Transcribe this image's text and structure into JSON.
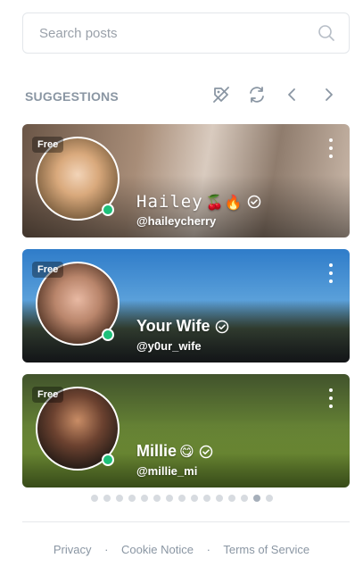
{
  "search": {
    "placeholder": "Search posts"
  },
  "suggestions": {
    "title": "SUGGESTIONS",
    "cards": [
      {
        "free_label": "Free",
        "name": "Hailey",
        "emoji": "🍒🔥",
        "handle": "@haileycherry",
        "verified": true,
        "online": true
      },
      {
        "free_label": "Free",
        "name": "Your Wife",
        "emoji": "",
        "handle": "@y0ur_wife",
        "verified": true,
        "online": true
      },
      {
        "free_label": "Free",
        "name": "Millie",
        "emoji": "😋",
        "handle": "@millie_mi",
        "verified": true,
        "online": true
      }
    ],
    "pagination": {
      "total": 15,
      "active_index": 13
    }
  },
  "footer": {
    "privacy": "Privacy",
    "cookie": "Cookie Notice",
    "terms": "Terms of Service",
    "separator": "·"
  },
  "colors": {
    "accent": "#8a96a3",
    "online": "#1ec07a",
    "border": "#e3e6ea"
  }
}
